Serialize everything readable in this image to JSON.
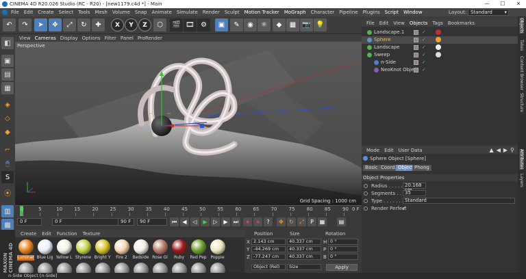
{
  "window": {
    "title": "CINEMA 4D R20.026 Studio (RC - R20) - [new1179.c4d *] - Main",
    "minimize": "—",
    "maximize": "☐",
    "close": "✕"
  },
  "menu": {
    "items": [
      "File",
      "Edit",
      "Create",
      "Select",
      "Tools",
      "Mesh",
      "Volume",
      "Snap",
      "Animate",
      "Simulate",
      "Render",
      "Sculpt",
      "Motion Tracker",
      "MoGraph",
      "Character",
      "Pipeline",
      "Plugins",
      "Script",
      "Window"
    ],
    "layout_label": "Layout:",
    "layout_value": "Standard"
  },
  "toolbar": {
    "axis_x": "X",
    "axis_y": "Y",
    "axis_z": "Z"
  },
  "viewport": {
    "menu": [
      "View",
      "Cameras",
      "Display",
      "Options",
      "Filter",
      "Panel",
      "ProRender"
    ],
    "label": "Perspective",
    "grid_spacing": "Grid Spacing : 1000 cm"
  },
  "timeline": {
    "ticks": [
      "0",
      "5",
      "10",
      "15",
      "20",
      "25",
      "30",
      "35",
      "40",
      "45",
      "50",
      "55",
      "60",
      "65",
      "70",
      "75",
      "80",
      "85",
      "90"
    ],
    "end_label": "0 F"
  },
  "transport": {
    "start_frame": "0 F",
    "current_frame": "0 F",
    "end_frame": "90 F",
    "max_frame": "90 F"
  },
  "materials": {
    "menu": [
      "Create",
      "Edit",
      "Function",
      "Texture"
    ],
    "items": [
      {
        "label": "Luminar",
        "color": "#e8831c"
      },
      {
        "label": "Blue Lig",
        "color": "#e6eef8"
      },
      {
        "label": "Yellow L",
        "color": "#f0f0e0"
      },
      {
        "label": "Styrene",
        "color": "#c8d44a"
      },
      {
        "label": "Bright Y",
        "color": "#d8c42a"
      },
      {
        "label": "Fire 2",
        "color": "#f4d4b0"
      },
      {
        "label": "Bedside",
        "color": "#f2ede0"
      },
      {
        "label": "Rose Gl",
        "color": "#b87a6a"
      },
      {
        "label": "Ruby",
        "color": "#a01818"
      },
      {
        "label": "Red Pep",
        "color": "#6aa02a"
      },
      {
        "label": "Poppie",
        "color": "#f0e6c0"
      }
    ]
  },
  "coordinates": {
    "header_position": "Position",
    "header_size": "Size",
    "header_rotation": "Rotation",
    "rows": [
      {
        "axis": "X",
        "pos": "2.143 cm",
        "size": "40.337 cm",
        "rot_axis": "H",
        "rot": "0 °"
      },
      {
        "axis": "Y",
        "pos": "-44.269 cm",
        "size": "40.337 cm",
        "rot_axis": "P",
        "rot": "0 °"
      },
      {
        "axis": "Z",
        "pos": "-77.247 cm",
        "size": "40.337 cm",
        "rot_axis": "B",
        "rot": "0 °"
      }
    ],
    "mode": "Object (Rel)",
    "size_mode": "Size",
    "apply": "Apply"
  },
  "objects": {
    "menu": [
      "File",
      "Edit",
      "View",
      "Objects",
      "Tags",
      "Bookmarks"
    ],
    "items": [
      {
        "name": "Landscape.1",
        "indent": 0,
        "icon_color": "#58b058",
        "tag_color": "#c03030"
      },
      {
        "name": "Sphere",
        "indent": 0,
        "icon_color": "#6090d0",
        "tag_color": "#f0a030",
        "active": true
      },
      {
        "name": "Landscape",
        "indent": 0,
        "icon_color": "#58b058",
        "tag_color": "#eeeeee"
      },
      {
        "name": "Sweep",
        "indent": 0,
        "icon_color": "#58b058",
        "tag_color": "#dddddd"
      },
      {
        "name": "n-Side",
        "indent": 1,
        "icon_color": "#5080c0",
        "tag_color": ""
      },
      {
        "name": "NeoKnot Object",
        "indent": 1,
        "icon_color": "#8060b0",
        "tag_color": ""
      }
    ]
  },
  "attributes": {
    "menu": [
      "Mode",
      "Edit",
      "User Data"
    ],
    "title": "Sphere Object [Sphere]",
    "tabs": [
      "Basic",
      "Coord.",
      "Object",
      "Phong"
    ],
    "active_tab": "Object",
    "section": "Object Properties",
    "props": [
      {
        "label": "Radius . . . . . . .",
        "value": "20.168 cm"
      },
      {
        "label": "Segments . . . . .",
        "value": "35"
      },
      {
        "label": "Type . . . . . . . . .",
        "value": "Standard"
      },
      {
        "label": "Render Perfect",
        "value": "✓"
      }
    ]
  },
  "sidetabs": [
    "Objects",
    "Takes",
    "Content Browser",
    "Structure",
    "Attributes",
    "Layers"
  ],
  "status": {
    "text": "n-Side Object [n-Side]"
  },
  "logo": "MAXON CINEMA 4D"
}
